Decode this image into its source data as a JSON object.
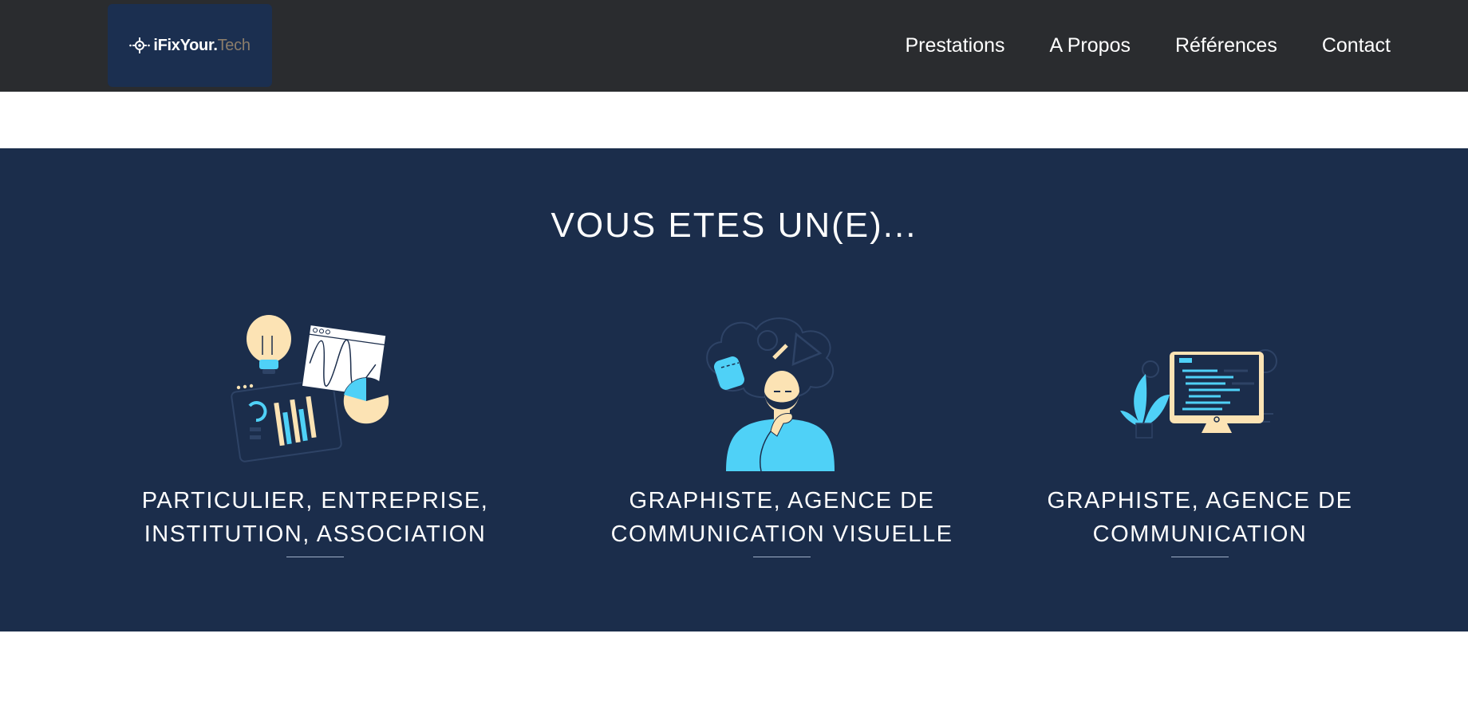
{
  "header": {
    "logo": {
      "text_main": "iFixYour.",
      "text_accent": "Tech"
    },
    "nav": [
      {
        "label": "Prestations"
      },
      {
        "label": "A Propos"
      },
      {
        "label": "Références"
      },
      {
        "label": "Contact"
      }
    ]
  },
  "hero": {
    "title": "VOUS ETES UN(E)...",
    "cards": [
      {
        "illustration": "lightbulb-analytics-illustration",
        "title_line1": "PARTICULIER, ENTREPRISE,",
        "title_line2": "INSTITUTION, ASSOCIATION"
      },
      {
        "illustration": "thinking-man-illustration",
        "title_line1": "GRAPHISTE, AGENCE DE",
        "title_line2": "COMMUNICATION VISUELLE"
      },
      {
        "illustration": "code-monitor-illustration",
        "title_line1": "GRAPHISTE, AGENCE DE",
        "title_line2": "COMMUNICATION"
      }
    ]
  },
  "colors": {
    "header_bg": "#2a2c2f",
    "logo_bg": "#1b2f50",
    "hero_bg": "#1b2d4b",
    "accent_cyan": "#4fd1f7",
    "accent_cream": "#fce3b4"
  }
}
